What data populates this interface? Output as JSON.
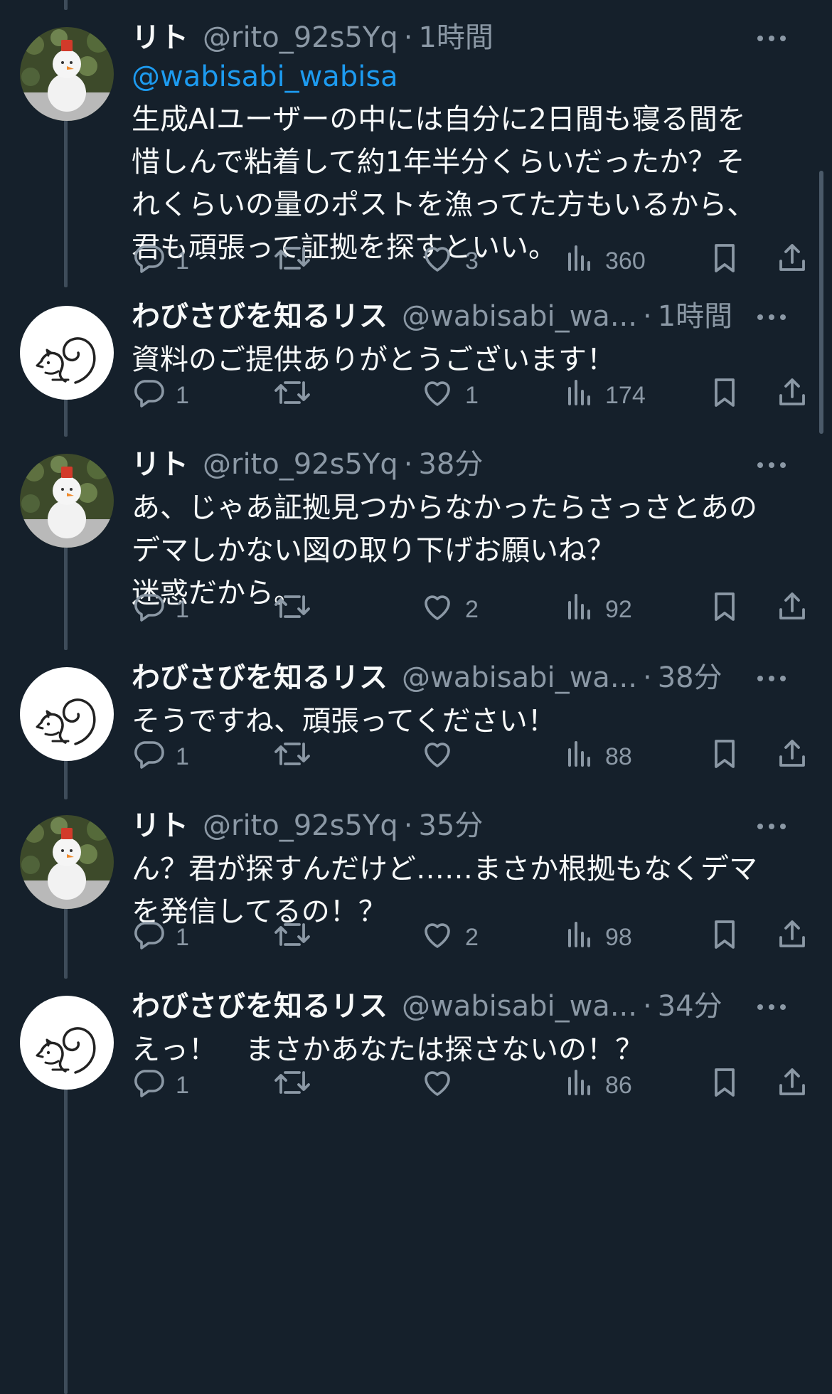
{
  "thread": {
    "tweets": [
      {
        "display_name": "リト",
        "handle": "@rito_92s5Yq",
        "time": "1時間",
        "avatar": "snowman-avatar",
        "mention": "@wabisabi_wabisa",
        "text_lines": [
          "生成AIユーザーの中には自分に2日間も寝る間を",
          "惜しんで粘着して約1年半分くらいだったか？そ",
          "れくらいの量のポストを漁ってた方もいるから、",
          "君も頑張って証拠を探すといい。"
        ],
        "replies": "1",
        "retweets": "",
        "likes": "3",
        "views": "360"
      },
      {
        "display_name": "わびさびを知るリス",
        "handle": "@wabisabi_wa...",
        "time": "1時間",
        "avatar": "squirrel-avatar",
        "mention": "",
        "text_lines": [
          "資料のご提供ありがとうございます！"
        ],
        "replies": "1",
        "retweets": "",
        "likes": "1",
        "views": "174"
      },
      {
        "display_name": "リト",
        "handle": "@rito_92s5Yq",
        "time": "38分",
        "avatar": "snowman-avatar",
        "mention": "",
        "text_lines": [
          "あ、じゃあ証拠見つからなかったらさっさとあの",
          "デマしかない図の取り下げお願いね？",
          "迷惑だから。"
        ],
        "replies": "1",
        "retweets": "",
        "likes": "2",
        "views": "92"
      },
      {
        "display_name": "わびさびを知るリス",
        "handle": "@wabisabi_wa...",
        "time": "38分",
        "avatar": "squirrel-avatar",
        "mention": "",
        "text_lines": [
          "そうですね、頑張ってください！"
        ],
        "replies": "1",
        "retweets": "",
        "likes": "",
        "views": "88"
      },
      {
        "display_name": "リト",
        "handle": "@rito_92s5Yq",
        "time": "35分",
        "avatar": "snowman-avatar",
        "mention": "",
        "text_lines": [
          "ん？君が探すんだけど……まさか根拠もなくデマ",
          "を発信してるの！？"
        ],
        "replies": "1",
        "retweets": "",
        "likes": "2",
        "views": "98"
      },
      {
        "display_name": "わびさびを知るリス",
        "handle": "@wabisabi_wa...",
        "time": "34分",
        "avatar": "squirrel-avatar",
        "mention": "",
        "text_lines": [
          "えっ！　まさかあなたは探さないの！？"
        ],
        "replies": "1",
        "retweets": "",
        "likes": "",
        "views": "86"
      }
    ]
  },
  "icons": {
    "reply": "reply-icon",
    "retweet": "retweet-icon",
    "like": "like-icon",
    "views": "views-icon",
    "bookmark": "bookmark-icon",
    "share": "share-icon",
    "more": "more-icon"
  },
  "colors": {
    "background": "#15202b",
    "text": "#f7f9f9",
    "secondary": "#8b98a5",
    "link": "#1d9bf0"
  }
}
